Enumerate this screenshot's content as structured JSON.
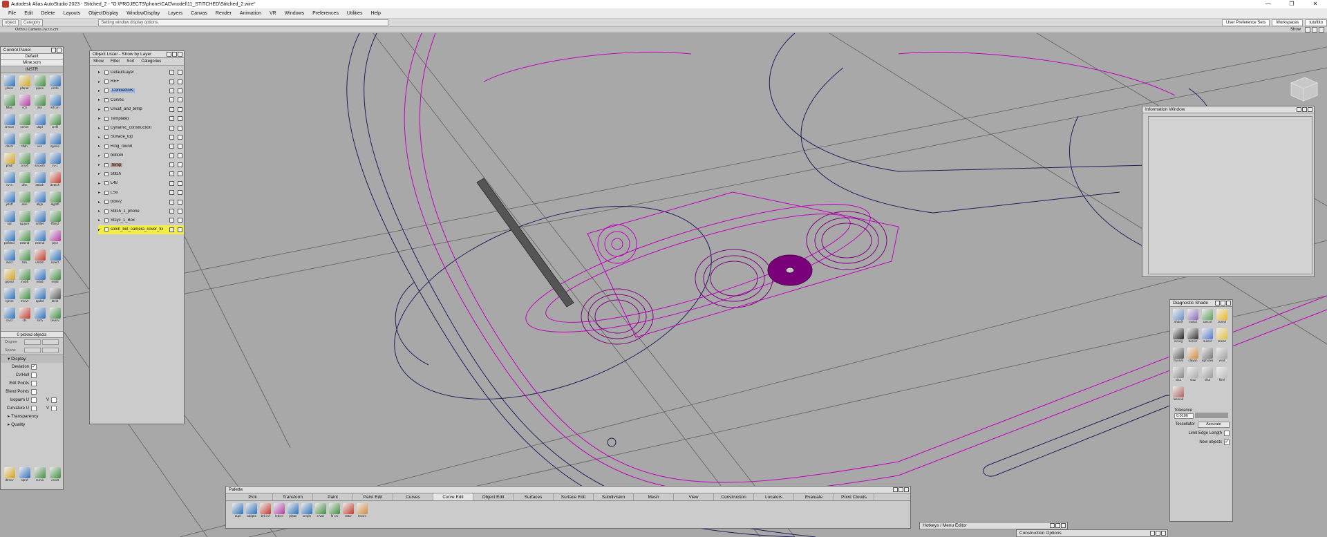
{
  "window": {
    "title": "Autodesk Alias AutoStudio 2023   - Stitched_2 - \"G:\\PROJECTS\\phone\\CAD\\model\\11_STITCHED\\Stitched_2.wire\"",
    "controls": [
      "—",
      "❐",
      "✕"
    ]
  },
  "menu": [
    "File",
    "Edit",
    "Delete",
    "Layouts",
    "ObjectDisplay",
    "WindowDisplay",
    "Layers",
    "Canvas",
    "Render",
    "Animation",
    "VR",
    "Windows",
    "Preferences",
    "Utilities",
    "Help"
  ],
  "toolstrip": {
    "left_boxes": [
      "object",
      "Category"
    ],
    "hint": "Setting window display options.",
    "right_tabs": [
      "User Preference Sets",
      "Workspaces"
    ],
    "user": "tutuftito"
  },
  "viewport_bar": {
    "camera_label": "Ortho | Camera | w.r.n.cm",
    "show": "Show"
  },
  "control_panel": {
    "title": "Control Panel",
    "preset": "Default",
    "file": "Mine.scm",
    "tab": "INSTR",
    "tools": [
      {
        "label": "plane",
        "color": "#2d6fb8"
      },
      {
        "label": "planar",
        "color": "#d0a31e"
      },
      {
        "label": "pipes",
        "color": "#3f8a3f"
      },
      {
        "label": "circle",
        "color": "#2d6fb8"
      },
      {
        "label": "filfan",
        "color": "#3f8a3f"
      },
      {
        "label": "sch",
        "color": "#b03aa0"
      },
      {
        "label": "skn",
        "color": "#3f8a3f"
      },
      {
        "label": "srfcon",
        "color": "#2d6fb8"
      },
      {
        "label": "crvcon",
        "color": "#2d6fb8"
      },
      {
        "label": "crvcvr",
        "color": "#3f8a3f"
      },
      {
        "label": "dupl",
        "color": "#2d6fb8"
      },
      {
        "label": "crvfil",
        "color": "#3f8a3f"
      },
      {
        "label": "clscrv",
        "color": "#2d6fb8"
      },
      {
        "label": "tfldn",
        "color": "#3f8a3f"
      },
      {
        "label": "vec",
        "color": "#2d6fb8"
      },
      {
        "label": "sgsmo",
        "color": "#2d6fb8"
      },
      {
        "label": "pfsdl",
        "color": "#d0a31e"
      },
      {
        "label": "crvoff",
        "color": "#3f8a3f"
      },
      {
        "label": "smooth",
        "color": "#2d6fb8"
      },
      {
        "label": "cv-1",
        "color": "#2d6fb8"
      },
      {
        "label": "cv-3",
        "color": "#2d6fb8"
      },
      {
        "label": "disc",
        "color": "#3f8a3f"
      },
      {
        "label": "attach",
        "color": "#2d6fb8"
      },
      {
        "label": "detach",
        "color": "#c0392b"
      },
      {
        "label": "jnfoff",
        "color": "#2d6fb8"
      },
      {
        "label": "skin",
        "color": "#3f8a3f"
      },
      {
        "label": "align",
        "color": "#2d6fb8"
      },
      {
        "label": "algntfl",
        "color": "#3f8a3f"
      },
      {
        "label": "rail",
        "color": "#2d6fb8"
      },
      {
        "label": "square",
        "color": "#3f8a3f"
      },
      {
        "label": "srfillet",
        "color": "#2d6fb8"
      },
      {
        "label": "ffblnd",
        "color": "#3f8a3f"
      },
      {
        "label": "pefblnd",
        "color": "#2d6fb8"
      },
      {
        "label": "extend",
        "color": "#3f8a3f"
      },
      {
        "label": "extend",
        "color": "#2d6fb8"
      },
      {
        "label": "prjct",
        "color": "#b03aa0"
      },
      {
        "label": "isect",
        "color": "#2d6fb8"
      },
      {
        "label": "trim",
        "color": "#3f8a3f"
      },
      {
        "label": "untrim",
        "color": "#c0392b"
      },
      {
        "label": "insert",
        "color": "#2d6fb8"
      },
      {
        "label": "grpvid",
        "color": "#d0a31e"
      },
      {
        "label": "mobff",
        "color": "#3f8a3f"
      },
      {
        "label": "rebld",
        "color": "#2d6fb8"
      },
      {
        "label": "rebld",
        "color": "#3f8a3f"
      },
      {
        "label": "symm",
        "color": "#2d6fb8"
      },
      {
        "label": "tmcvt",
        "color": "#3f8a3f"
      },
      {
        "label": "apdtd",
        "color": "#2d6fb8"
      },
      {
        "label": "dtest",
        "color": "#555555"
      },
      {
        "label": "crvcr",
        "color": "#2d6fb8"
      },
      {
        "label": "cfs",
        "color": "#c0392b"
      },
      {
        "label": "stch",
        "color": "#2d6fb8"
      },
      {
        "label": "revsrv",
        "color": "#3f8a3f"
      }
    ],
    "picked": "0 picked objects",
    "props": [
      "Degree",
      "Spans"
    ],
    "display_header": "Display",
    "display_rows": [
      {
        "label": "Deviation",
        "checked": "✓"
      },
      {
        "label": "Cv/Hull",
        "checked": ""
      },
      {
        "label": "Edit Points",
        "checked": ""
      },
      {
        "label": "Blend Points",
        "checked": ""
      },
      {
        "label": "Isoparm U",
        "checked": "",
        "v": "V"
      },
      {
        "label": "Curvature U",
        "checked": "",
        "v": "V"
      }
    ],
    "sections": [
      "Transparency",
      "Quality"
    ],
    "bottom_tools": [
      {
        "label": "dtmcv",
        "color": "#d0a31e"
      },
      {
        "label": "sprof",
        "color": "#2d6fb8"
      },
      {
        "label": "curva",
        "color": "#3f8a3f"
      },
      {
        "label": "csedt",
        "color": "#3f8a3f"
      }
    ]
  },
  "object_lister": {
    "title": "Object Lister - Show by Layer",
    "menu": [
      "Show",
      "Filter",
      "Sort",
      "Categories"
    ],
    "items": [
      {
        "name": "DefaultLayer",
        "style": ""
      },
      {
        "name": "REF",
        "style": ""
      },
      {
        "name": "Connectors",
        "style": "sel-blue"
      },
      {
        "name": "Curves",
        "style": ""
      },
      {
        "name": "Uncut_and_temp",
        "style": ""
      },
      {
        "name": "Templates",
        "style": ""
      },
      {
        "name": "Dynamic_construction",
        "style": ""
      },
      {
        "name": "Surface_top",
        "style": ""
      },
      {
        "name": "Ring_round",
        "style": ""
      },
      {
        "name": "bottom",
        "style": ""
      },
      {
        "name": "temp",
        "style": "sel-brown"
      },
      {
        "name": "Stitch",
        "style": ""
      },
      {
        "name": "L48",
        "style": ""
      },
      {
        "name": "LS0",
        "style": ""
      },
      {
        "name": "box#2",
        "style": ""
      },
      {
        "name": "Stitch_1_phone",
        "style": ""
      },
      {
        "name": "Stsyc_1_Box",
        "style": ""
      },
      {
        "name": "stitch_bot_camera_cover_fix",
        "style": "sel-yellow"
      }
    ]
  },
  "info_window": {
    "title": "Information Window"
  },
  "diagnostic_shade": {
    "title": "Diagnostic Shade",
    "tools": [
      {
        "label": "shdoff",
        "color": "#6a8fc8"
      },
      {
        "label": "multcl",
        "color": "#8a6ab8"
      },
      {
        "label": "rancol",
        "color": "#5aa05a"
      },
      {
        "label": "curevl",
        "color": "#e8b820"
      },
      {
        "label": "iscurg",
        "color": "#222222"
      },
      {
        "label": "horver",
        "color": "#303030"
      },
      {
        "label": "surevl",
        "color": "#5577cc"
      },
      {
        "label": "srarsz",
        "color": "#e0c040"
      },
      {
        "label": "frusnal",
        "color": "#555555"
      },
      {
        "label": "clayan",
        "color": "#d08a40"
      },
      {
        "label": "isphotes",
        "color": "#777777"
      },
      {
        "label": "vred",
        "color": "#a0a0a0"
      },
      {
        "label": "vis1",
        "color": "#888888"
      },
      {
        "label": "vis2",
        "color": "#aaaaaa"
      },
      {
        "label": "vis3",
        "color": "#999999"
      },
      {
        "label": "filrel",
        "color": "#bbbbbb"
      },
      {
        "label": "lasmod",
        "color": "#b06060"
      }
    ],
    "tolerance_label": "Tolerance",
    "tolerance_value": "0.0100",
    "tessellator_label": "Tessellator",
    "tessellator_value": "Accurate",
    "limit_edge": "Limit Edge Length",
    "new_objects": "New objects",
    "new_objects_checked": "✓"
  },
  "palette": {
    "title": "Palette",
    "tabs": [
      "Pick",
      "Transform",
      "Paint",
      "Paint Edit",
      "Curves",
      "Curve Edit",
      "Object Edit",
      "Surfaces",
      "Surface Edit",
      "Subdivision",
      "Mesh",
      "View",
      "Construction",
      "Locators",
      "Evaluate",
      "Point Clouds"
    ],
    "active_tab": "Curve Edit",
    "tools": [
      {
        "label": "dupl",
        "color": "#2d6fb8"
      },
      {
        "label": "addpts",
        "color": "#2d6fb8"
      },
      {
        "label": "brk inf",
        "color": "#c0392b"
      },
      {
        "label": "rebcrv",
        "color": "#b03aa0"
      },
      {
        "label": "prjtan",
        "color": "#2d6fb8"
      },
      {
        "label": "crvpln",
        "color": "#2d6fb8"
      },
      {
        "label": "crvtcr",
        "color": "#3f8a3f"
      },
      {
        "label": "fit crv",
        "color": "#3f8a3f"
      },
      {
        "label": "stttcr",
        "color": "#c0392b"
      },
      {
        "label": "revsrv",
        "color": "#d08a40"
      }
    ]
  },
  "hotkeys_bar": {
    "title": "Hotkeys / Menu Editor"
  },
  "construction_bar": {
    "title": "Construction Options"
  },
  "colors": {
    "viewport_bg": "#a8a8a8",
    "curve_magenta": "#c000c0",
    "curve_navy": "#1e1e5a",
    "curve_grey": "#6e6e6e"
  }
}
